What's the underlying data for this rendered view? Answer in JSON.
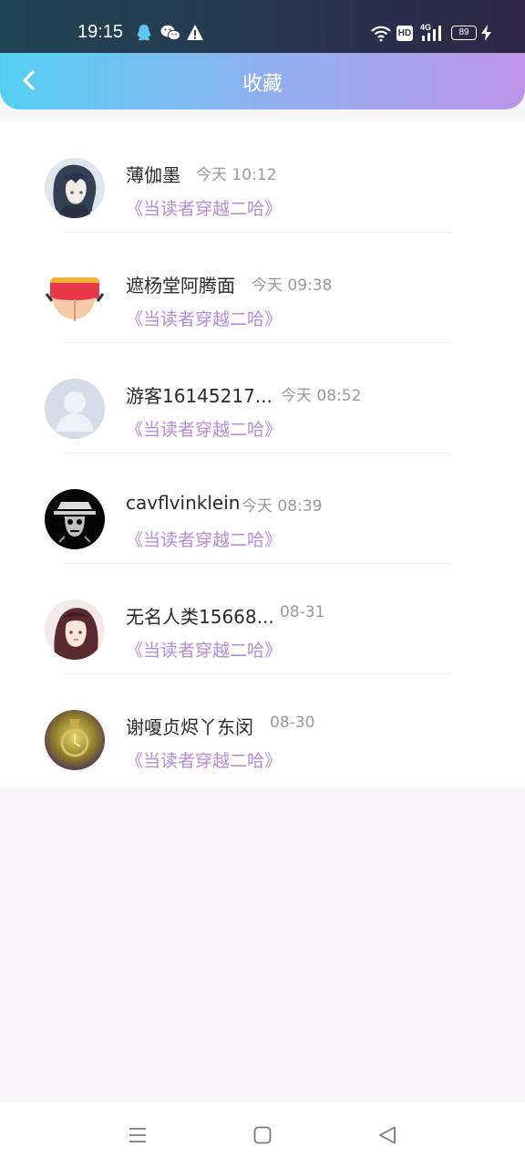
{
  "status_bar": {
    "time": "19:15",
    "icons": [
      "qq-icon",
      "wechat-icon",
      "warning-icon",
      "wifi-icon",
      "hd-icon",
      "signal-4g-icon",
      "battery-icon",
      "charging-icon"
    ],
    "hd_label": "HD",
    "network_label": "4G",
    "battery_level": "89"
  },
  "header": {
    "title": "收藏",
    "back_icon": "chevron-left-icon",
    "gradient": [
      "#55d0f4",
      "#bd95e9"
    ]
  },
  "favorites": [
    {
      "user": "薄伽墨",
      "time": "今天 10:12",
      "book": "《当读者穿越二哈》"
    },
    {
      "user": "遮杨堂阿腾面",
      "time": "今天 09:38",
      "book": "《当读者穿越二哈》"
    },
    {
      "user": "游客16145217...",
      "time": "今天 08:52",
      "book": "《当读者穿越二哈》"
    },
    {
      "user": "cavflvinklein",
      "time": "今天 08:39",
      "book": "《当读者穿越二哈》"
    },
    {
      "user": "无名人类15668...",
      "time": "08-31",
      "book": "《当读者穿越二哈》"
    },
    {
      "user": "谢嗄贞烬丫东闵",
      "time": "08-30",
      "book": "《当读者穿越二哈》"
    }
  ],
  "nav_bar": {
    "icons": [
      "menu-icon",
      "home-icon",
      "back-triangle-icon"
    ]
  },
  "colors": {
    "accent": "#b58bdb",
    "name_text": "#2a2a2a",
    "time_text": "#9a9a9a"
  }
}
